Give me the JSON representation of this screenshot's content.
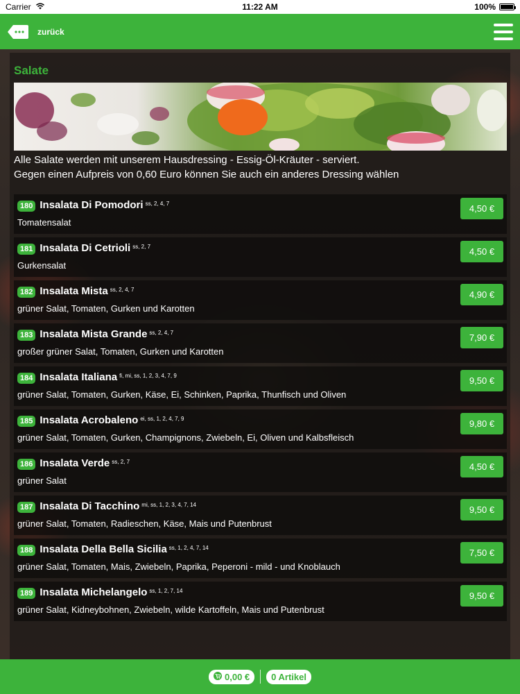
{
  "status_bar": {
    "carrier": "Carrier",
    "time": "11:22 AM",
    "battery": "100%",
    "battery_level": 1.0
  },
  "header": {
    "back_label": "zurück"
  },
  "category": {
    "title": "Salate",
    "intro_line1": "Alle Salate werden mit unserem Hausdressing - Essig-Öl-Kräuter - serviert.",
    "intro_line2": "Gegen einen Aufpreis von 0,60 Euro können Sie auch ein anderes Dressing wählen"
  },
  "items": [
    {
      "number": "180",
      "name": "Insalata Di Pomodori",
      "additives": "ss, 2, 4, 7",
      "description": "Tomatensalat",
      "price": "4,50 €"
    },
    {
      "number": "181",
      "name": "Insalata Di Cetrioli",
      "additives": "ss, 2, 7",
      "description": "Gurkensalat",
      "price": "4,50 €"
    },
    {
      "number": "182",
      "name": "Insalata Mista",
      "additives": "ss, 2, 4, 7",
      "description": "grüner Salat, Tomaten, Gurken und Karotten",
      "price": "4,90 €"
    },
    {
      "number": "183",
      "name": "Insalata Mista Grande",
      "additives": "ss, 2, 4, 7",
      "description": "großer grüner Salat, Tomaten, Gurken und Karotten",
      "price": "7,90 €"
    },
    {
      "number": "184",
      "name": "Insalata Italiana",
      "additives": "fi, mi, ss, 1, 2, 3, 4, 7, 9",
      "description": "grüner Salat, Tomaten, Gurken, Käse, Ei, Schinken, Paprika, Thunfisch und Oliven",
      "price": "9,50 €"
    },
    {
      "number": "185",
      "name": "Insalata Acrobaleno",
      "additives": "ei, ss, 1, 2, 4, 7, 9",
      "description": "grüner Salat, Tomaten, Gurken, Champignons, Zwiebeln, Ei, Oliven und Kalbsfleisch",
      "price": "9,80 €"
    },
    {
      "number": "186",
      "name": "Insalata Verde",
      "additives": "ss, 2, 7",
      "description": "grüner Salat",
      "price": "4,50 €"
    },
    {
      "number": "187",
      "name": "Insalata Di Tacchino",
      "additives": "mi, ss, 1, 2, 3, 4, 7, 14",
      "description": "grüner Salat, Tomaten, Radieschen, Käse, Mais und Putenbrust",
      "price": "9,50 €"
    },
    {
      "number": "188",
      "name": "Insalata Della Bella Sicilia",
      "additives": "ss, 1, 2, 4, 7, 14",
      "description": "grüner Salat, Tomaten, Mais, Zwiebeln, Paprika, Peperoni - mild - und Knoblauch",
      "price": "7,50 €"
    },
    {
      "number": "189",
      "name": "Insalata Michelangelo",
      "additives": "ss, 1, 2, 7, 14",
      "description": "grüner Salat, Kidneybohnen, Zwiebeln, wilde Kartoffeln, Mais und Putenbrust",
      "price": "9,50 €"
    }
  ],
  "footer": {
    "cart_total": "0,00 €",
    "article_count": "0 Artikel"
  },
  "colors": {
    "brand_green": "#3db33b",
    "item_background": "#0c0b0a"
  },
  "icons": {
    "back": "back-arrow-icon",
    "menu": "hamburger-menu-icon",
    "cart": "cart-icon",
    "wifi": "wifi-icon",
    "battery": "battery-icon"
  }
}
